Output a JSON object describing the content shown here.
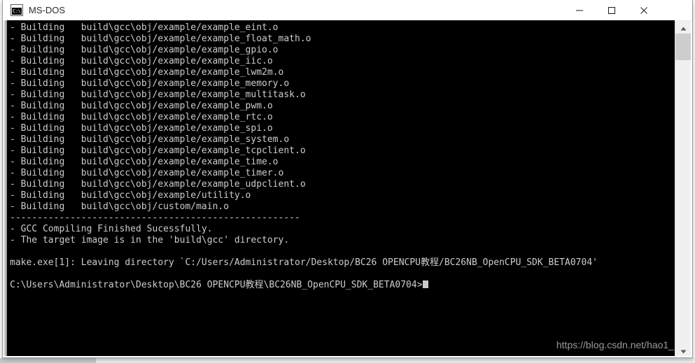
{
  "window": {
    "title": "MS-DOS",
    "icon": "console-icon",
    "icon_glyph": "C:\\_",
    "controls": {
      "minimize": "Minimize",
      "maximize": "Maximize",
      "close": "Close"
    }
  },
  "console": {
    "background": "#000000",
    "foreground": "#cccccc",
    "lines": [
      "- Building   build\\gcc\\obj/example/example_eint.o",
      "- Building   build\\gcc\\obj/example/example_float_math.o",
      "- Building   build\\gcc\\obj/example/example_gpio.o",
      "- Building   build\\gcc\\obj/example/example_iic.o",
      "- Building   build\\gcc\\obj/example/example_lwm2m.o",
      "- Building   build\\gcc\\obj/example/example_memory.o",
      "- Building   build\\gcc\\obj/example/example_multitask.o",
      "- Building   build\\gcc\\obj/example/example_pwm.o",
      "- Building   build\\gcc\\obj/example/example_rtc.o",
      "- Building   build\\gcc\\obj/example/example_spi.o",
      "- Building   build\\gcc\\obj/example/example_system.o",
      "- Building   build\\gcc\\obj/example/example_tcpclient.o",
      "- Building   build\\gcc\\obj/example/example_time.o",
      "- Building   build\\gcc\\obj/example/example_timer.o",
      "- Building   build\\gcc\\obj/example/example_udpclient.o",
      "- Building   build\\gcc\\obj/example/utility.o",
      "- Building   build\\gcc\\obj/custom/main.o",
      "-----------------------------------------------------",
      "- GCC Compiling Finished Sucessfully.",
      "- The target image is in the 'build\\gcc' directory.",
      "",
      "make.exe[1]: Leaving directory `C:/Users/Administrator/Desktop/BC26 OPENCPU教程/BC26NB_OpenCPU_SDK_BETA0704'",
      "",
      "C:\\Users\\Administrator\\Desktop\\BC26 OPENCPU教程\\BC26NB_OpenCPU_SDK_BETA0704>"
    ]
  },
  "watermark": {
    "text": "https://blog.csdn.net/hao1_"
  },
  "scrollbar": {
    "up_arrow": "scroll-up-icon",
    "down_arrow": "scroll-down-icon",
    "thumb": "scroll-thumb"
  }
}
